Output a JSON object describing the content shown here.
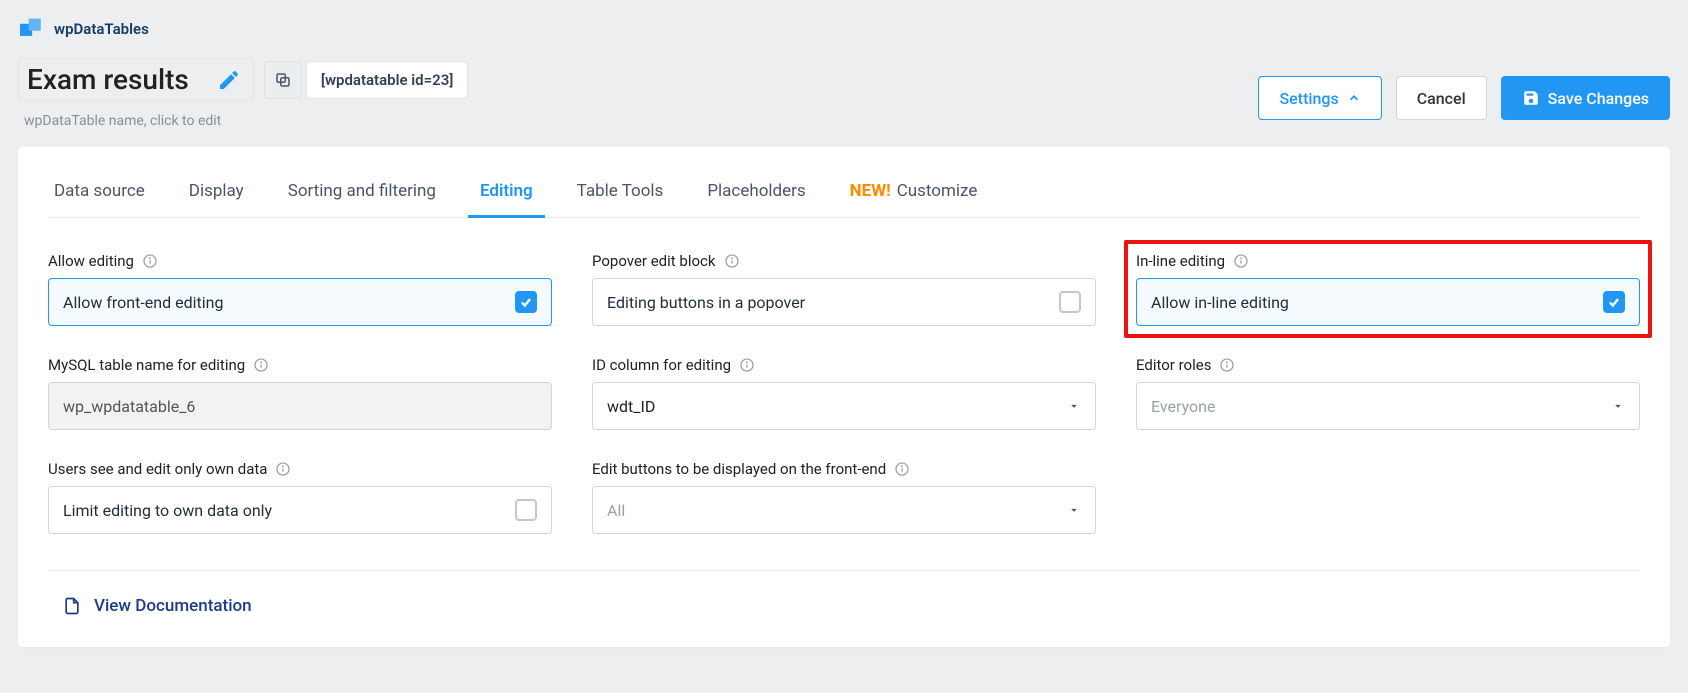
{
  "brand": {
    "name": "wpDataTables"
  },
  "header": {
    "title": "Exam results",
    "title_hint": "wpDataTable name, click to edit",
    "shortcode": "[wpdatatable id=23]",
    "settings_label": "Settings",
    "cancel_label": "Cancel",
    "save_label": "Save Changes"
  },
  "tabs": [
    {
      "label": "Data source"
    },
    {
      "label": "Display"
    },
    {
      "label": "Sorting and filtering"
    },
    {
      "label": "Editing",
      "active": true
    },
    {
      "label": "Table Tools"
    },
    {
      "label": "Placeholders"
    },
    {
      "label": "Customize",
      "new_prefix": "NEW!"
    }
  ],
  "editing": {
    "allow_editing": {
      "label": "Allow editing",
      "box_text": "Allow front-end editing",
      "checked": true
    },
    "popover_block": {
      "label": "Popover edit block",
      "box_text": "Editing buttons in a popover",
      "checked": false
    },
    "inline_editing": {
      "label": "In-line editing",
      "box_text": "Allow in-line editing",
      "checked": true
    },
    "mysql_table": {
      "label": "MySQL table name for editing",
      "value": "wp_wpdatatable_6"
    },
    "id_column": {
      "label": "ID column for editing",
      "value": "wdt_ID"
    },
    "editor_roles": {
      "label": "Editor roles",
      "placeholder": "Everyone"
    },
    "own_data": {
      "label": "Users see and edit only own data",
      "box_text": "Limit editing to own data only",
      "checked": false
    },
    "edit_buttons": {
      "label": "Edit buttons to be displayed on the front-end",
      "value": "All"
    }
  },
  "footer": {
    "doc_link": "View Documentation"
  }
}
